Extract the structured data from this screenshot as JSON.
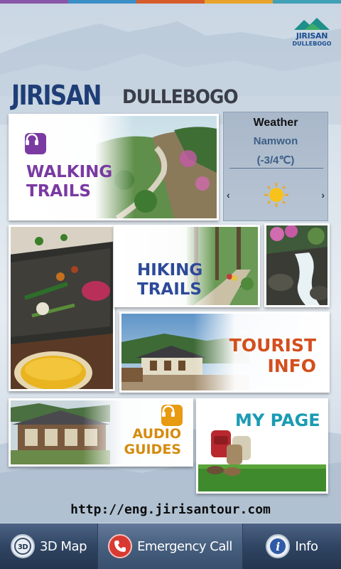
{
  "colors": {
    "strip": [
      "#8a56a8",
      "#3a8fc6",
      "#d65c2b",
      "#e8a32c",
      "#3fa0b6"
    ],
    "walking": "#7a3aa2",
    "hiking": "#2d4a9a",
    "tourist": "#d34f1d",
    "audio": "#d58b0e",
    "mypage": "#1a9bb3",
    "nav_bg": "#304563"
  },
  "logo": {
    "line1": "JIRISAN",
    "line2": "DULLEBOGO"
  },
  "title": {
    "part1": "JIRISAN",
    "part2": "DULLEBOGO"
  },
  "tiles": {
    "walking": {
      "line1": "WALKING",
      "line2": "TRAILS",
      "icon": "headphones-icon"
    },
    "hiking": {
      "line1": "HIKING",
      "line2": "TRAILS"
    },
    "tourist": {
      "line1": "TOURIST",
      "line2": "INFO"
    },
    "audio": {
      "line1": "AUDIO",
      "line2": "GUIDES",
      "icon": "headphones-icon"
    },
    "mypage": {
      "label": "MY PAGE"
    }
  },
  "weather": {
    "title": "Weather",
    "city": "Namwon",
    "temp": "(-3/4℃)",
    "condition_icon": "sun-icon",
    "prev": "‹",
    "next": "›"
  },
  "url": "http://eng.jirisantour.com",
  "nav": {
    "map": {
      "label": "3D Map",
      "icon": "3d-map-icon"
    },
    "emergency": {
      "label": "Emergency Call",
      "icon": "phone-icon"
    },
    "info": {
      "label": "Info",
      "icon": "info-icon"
    }
  }
}
